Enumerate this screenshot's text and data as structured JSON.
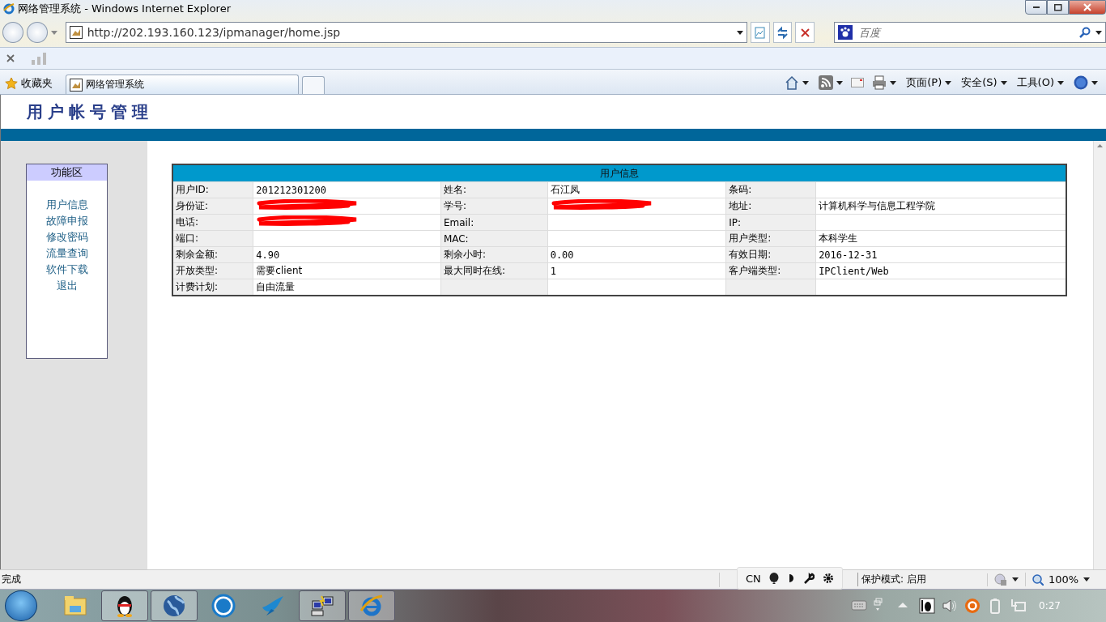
{
  "window": {
    "title": "网络管理系统 - Windows Internet Explorer"
  },
  "address_bar": {
    "url": "http://202.193.160.123/ipmanager/home.jsp"
  },
  "search": {
    "placeholder": "百度"
  },
  "favorites_label": "收藏夹",
  "tabs": [
    {
      "label": "网络管理系统",
      "selected": true
    },
    {
      "selected": false
    }
  ],
  "command_menus": [
    "页面(P)",
    "安全(S)",
    "工具(O)"
  ],
  "page": {
    "title": "用户帐号管理",
    "sidebar": {
      "title": "功能区",
      "items": [
        "用户信息",
        "故障申报",
        "修改密码",
        "流量查询",
        "软件下载",
        "退出"
      ]
    },
    "table": {
      "title": "用户信息",
      "rows": [
        [
          {
            "kind": "label",
            "text": "用户ID:"
          },
          {
            "kind": "value",
            "text": "201212301200"
          },
          {
            "kind": "label",
            "text": "姓名:"
          },
          {
            "kind": "value",
            "text": "石江凤"
          },
          {
            "kind": "label",
            "text": "条码:"
          },
          {
            "kind": "value"
          }
        ],
        [
          {
            "kind": "label",
            "text": "身份证:"
          },
          {
            "kind": "redacted"
          },
          {
            "kind": "label",
            "text": "学号:"
          },
          {
            "kind": "redacted"
          },
          {
            "kind": "label",
            "text": "地址:"
          },
          {
            "kind": "value",
            "text": "计算机科学与信息工程学院"
          }
        ],
        [
          {
            "kind": "label",
            "text": "电话:"
          },
          {
            "kind": "redacted"
          },
          {
            "kind": "label",
            "text": "Email:"
          },
          {
            "kind": "value"
          },
          {
            "kind": "label",
            "text": "IP:"
          },
          {
            "kind": "value"
          }
        ],
        [
          {
            "kind": "label",
            "text": "端口:"
          },
          {
            "kind": "value"
          },
          {
            "kind": "label",
            "text": "MAC:"
          },
          {
            "kind": "value"
          },
          {
            "kind": "label",
            "text": "用户类型:"
          },
          {
            "kind": "value",
            "text": "本科学生"
          }
        ],
        [
          {
            "kind": "label",
            "text": "剩余金额:"
          },
          {
            "kind": "value",
            "text": "4.90"
          },
          {
            "kind": "label",
            "text": "剩余小时:"
          },
          {
            "kind": "value",
            "text": "0.00"
          },
          {
            "kind": "label",
            "text": "有效日期:"
          },
          {
            "kind": "value",
            "text": "2016-12-31"
          }
        ],
        [
          {
            "kind": "label",
            "text": "开放类型:"
          },
          {
            "kind": "value",
            "text": "需要client"
          },
          {
            "kind": "label",
            "text": "最大同时在线:"
          },
          {
            "kind": "value",
            "text": "1"
          },
          {
            "kind": "label",
            "text": "客户端类型:"
          },
          {
            "kind": "value",
            "text": "IPClient/Web"
          }
        ],
        [
          {
            "kind": "label",
            "text": "计费计划:"
          },
          {
            "kind": "value",
            "text": "自由流量"
          },
          {
            "kind": "label"
          },
          {
            "kind": "value"
          },
          {
            "kind": "label"
          },
          {
            "kind": "value"
          }
        ]
      ]
    }
  },
  "status_bar": {
    "text": "完成",
    "protected_mode": "保护模式: 启用",
    "zoom": "100%"
  },
  "language_bar": {
    "label": "CN"
  },
  "taskbar": {
    "clock": "0:27"
  }
}
